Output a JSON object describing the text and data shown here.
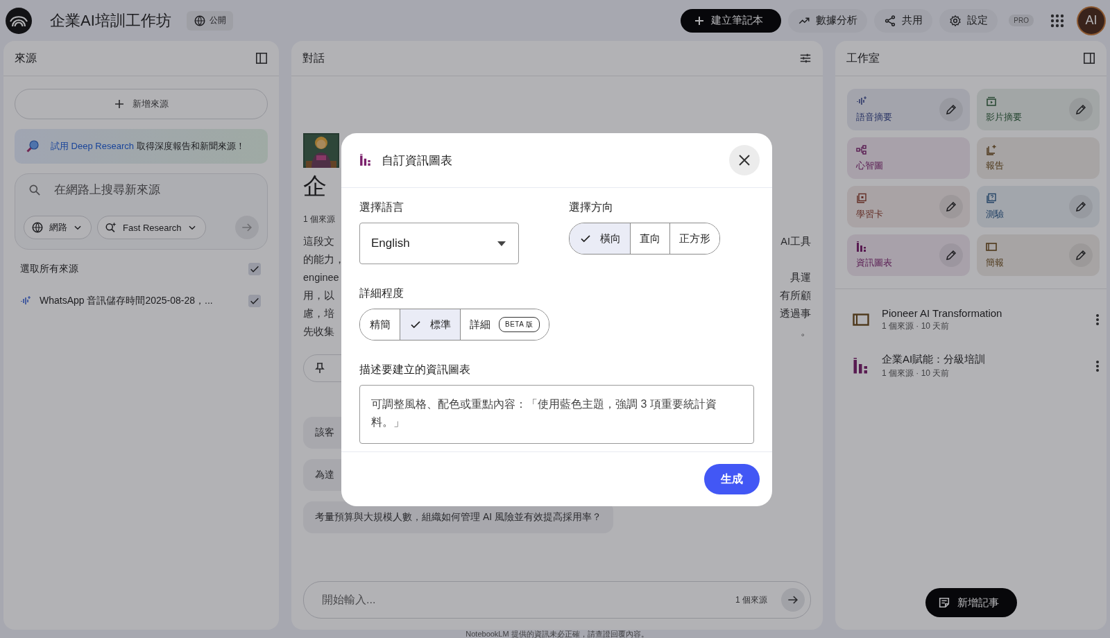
{
  "top_bar": {
    "title": "企業AI培訓工作坊",
    "visibility": "公開",
    "create_button": "建立筆記本",
    "actions": [
      {
        "label": "數據分析",
        "kind": "analytics"
      },
      {
        "label": "共用",
        "kind": "share"
      },
      {
        "label": "設定",
        "kind": "settings"
      }
    ],
    "plan_badge": "PRO",
    "avatar": "AI"
  },
  "sources_panel": {
    "title": "來源",
    "add_button": "新增來源",
    "banner": {
      "link": "試用 Deep Research",
      "text": "取得深度報告和新聞來源！"
    },
    "search": {
      "placeholder": "在網路上搜尋新來源",
      "filters": [
        {
          "label": "網路",
          "kind": "web"
        },
        {
          "label": "Fast Research",
          "kind": "research"
        }
      ]
    },
    "select_all": {
      "label": "選取所有來源",
      "checked": true
    },
    "sources": [
      {
        "title": "WhatsApp 音訊儲存時間2025-08-28，...",
        "checked": true
      }
    ]
  },
  "chat_panel": {
    "title": "對話",
    "heading": "企",
    "source_count": "1 個來源",
    "summary_lines": [
      {
        "left": "這段文",
        "right": "AI工具"
      },
      {
        "left": "的能力，"
      },
      {
        "left": "enginee",
        "right": "具運"
      },
      {
        "left": "用，以",
        "right": "有所顧"
      },
      {
        "left": "慮，培",
        "right": "透過事"
      },
      {
        "left": "先收集",
        "right": "。"
      }
    ],
    "suggestions": [
      "該客",
      "為達",
      "考量預算與大規模人數，組織如何管理 AI 風險並有效提高採用率？"
    ],
    "input": {
      "placeholder": "開始輸入...",
      "source_count": "1 個來源"
    },
    "disclaimer": "NotebookLM 提供的資訊未必正確，請查證回覆內容。"
  },
  "studio_panel": {
    "title": "工作室",
    "tools": [
      {
        "label": "語音摘要",
        "kind": "audio",
        "editable": true
      },
      {
        "label": "影片摘要",
        "kind": "video",
        "editable": true
      },
      {
        "label": "心智圖",
        "kind": "mindmap",
        "editable": false
      },
      {
        "label": "報告",
        "kind": "report",
        "editable": false
      },
      {
        "label": "學習卡",
        "kind": "flashcard",
        "editable": true
      },
      {
        "label": "測驗",
        "kind": "quiz",
        "editable": true
      },
      {
        "label": "資訊圖表",
        "kind": "infographic",
        "editable": true
      },
      {
        "label": "簡報",
        "kind": "slides",
        "editable": true
      }
    ],
    "notes": [
      {
        "title": "Pioneer AI Transformation",
        "meta": "1 個來源 · 10 天前",
        "kind": "slides"
      },
      {
        "title": "企業AI賦能：分級培訓",
        "meta": "1 個來源 · 10 天前",
        "kind": "infographic"
      }
    ],
    "add_note_button": "新增記事"
  },
  "dialog": {
    "title": "自訂資訊圖表",
    "language": {
      "label": "選擇語言",
      "value": "English"
    },
    "orientation": {
      "label": "選擇方向",
      "options": [
        {
          "label": "橫向",
          "selected": true
        },
        {
          "label": "直向",
          "selected": false
        },
        {
          "label": "正方形",
          "selected": false
        }
      ]
    },
    "detail": {
      "label": "詳細程度",
      "options": [
        {
          "label": "精簡",
          "selected": false
        },
        {
          "label": "標準",
          "selected": true
        },
        {
          "label": "詳細",
          "selected": false,
          "badge": "BETA 版"
        }
      ]
    },
    "description": {
      "label": "描述要建立的資訊圖表",
      "placeholder": "可調整風格、配色或重點內容：「使用藍色主題，強調 3 項重要統計資料。」"
    },
    "submit_button": "生成"
  }
}
